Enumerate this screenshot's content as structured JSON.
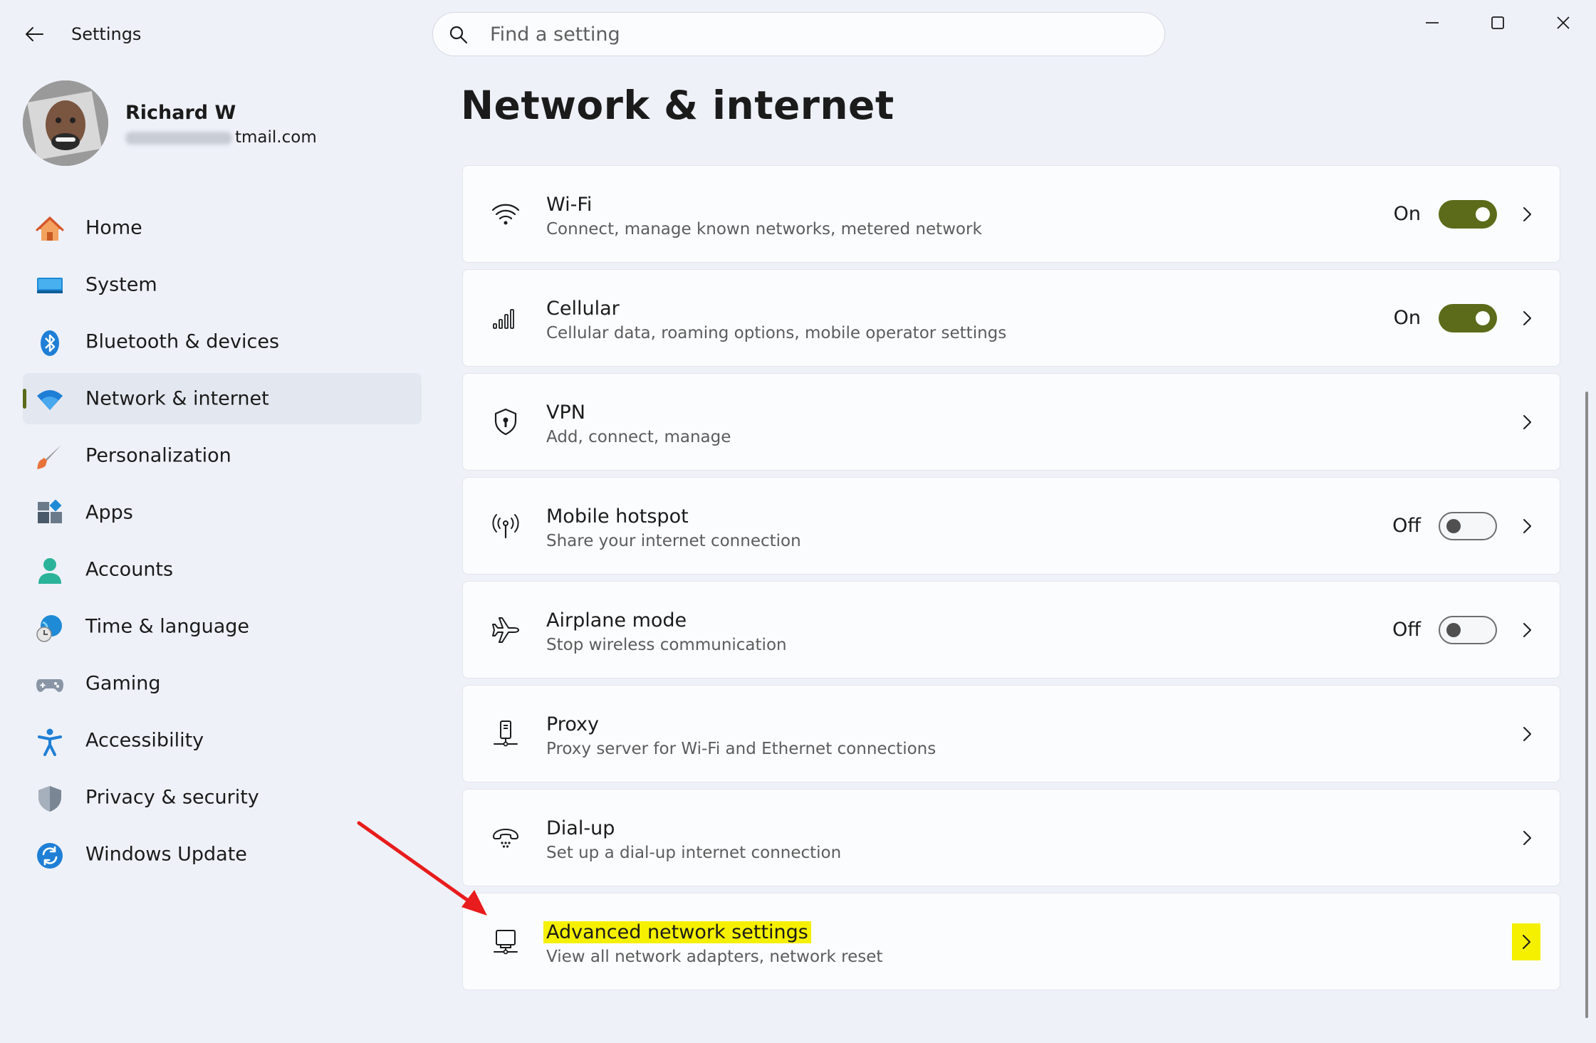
{
  "window": {
    "title": "Settings",
    "search_placeholder": "Find a setting"
  },
  "profile": {
    "name": "Richard W",
    "email_visible": "tmail.com"
  },
  "nav": [
    {
      "label": "Home",
      "icon": "home-icon"
    },
    {
      "label": "System",
      "icon": "system-icon"
    },
    {
      "label": "Bluetooth & devices",
      "icon": "bluetooth-icon"
    },
    {
      "label": "Network & internet",
      "icon": "wifi-icon",
      "active": true
    },
    {
      "label": "Personalization",
      "icon": "brush-icon"
    },
    {
      "label": "Apps",
      "icon": "apps-icon"
    },
    {
      "label": "Accounts",
      "icon": "accounts-icon"
    },
    {
      "label": "Time & language",
      "icon": "globe-clock-icon"
    },
    {
      "label": "Gaming",
      "icon": "gamepad-icon"
    },
    {
      "label": "Accessibility",
      "icon": "accessibility-icon"
    },
    {
      "label": "Privacy & security",
      "icon": "shield-icon"
    },
    {
      "label": "Windows Update",
      "icon": "update-icon"
    }
  ],
  "main": {
    "title": "Network & internet",
    "items": [
      {
        "title": "Wi-Fi",
        "subtitle": "Connect, manage known networks, metered network",
        "state": "On",
        "icon": "wifi-icon"
      },
      {
        "title": "Cellular",
        "subtitle": "Cellular data, roaming options, mobile operator settings",
        "state": "On",
        "icon": "cellular-icon"
      },
      {
        "title": "VPN",
        "subtitle": "Add, connect, manage",
        "icon": "vpn-shield-icon"
      },
      {
        "title": "Mobile hotspot",
        "subtitle": "Share your internet connection",
        "state": "Off",
        "icon": "hotspot-icon"
      },
      {
        "title": "Airplane mode",
        "subtitle": "Stop wireless communication",
        "state": "Off",
        "icon": "airplane-icon"
      },
      {
        "title": "Proxy",
        "subtitle": "Proxy server for Wi-Fi and Ethernet connections",
        "icon": "proxy-icon"
      },
      {
        "title": "Dial-up",
        "subtitle": "Set up a dial-up internet connection",
        "icon": "dialup-icon"
      },
      {
        "title": "Advanced network settings",
        "subtitle": "View all network adapters, network reset",
        "icon": "advanced-network-icon",
        "highlighted": true
      }
    ]
  },
  "colors": {
    "accent": "#5b6b1a",
    "highlight": "#f5f000",
    "annotation_arrow": "#e81c1c",
    "background": "#eef1f8",
    "card": "#fbfcfe"
  }
}
